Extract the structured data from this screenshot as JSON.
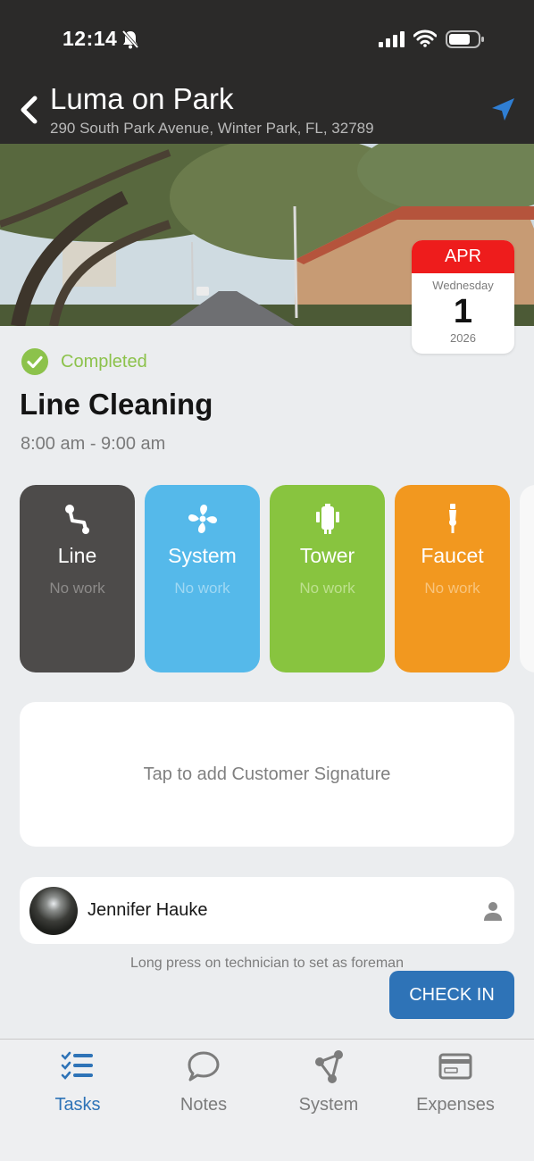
{
  "status_bar": {
    "time": "12:14"
  },
  "header": {
    "title": "Luma on Park",
    "address": "290 South Park Avenue, Winter Park, FL, 32789"
  },
  "date": {
    "month": "APR",
    "weekday": "Wednesday",
    "day": "1",
    "year": "2026"
  },
  "task": {
    "status": "Completed",
    "title": "Line Cleaning",
    "time": "8:00 am - 9:00 am"
  },
  "tiles": [
    {
      "label": "Line",
      "sub": "No work",
      "icon": "line-icon",
      "color": "#4d4b4a"
    },
    {
      "label": "System",
      "sub": "No work",
      "icon": "fan-icon",
      "color": "#55b9ea"
    },
    {
      "label": "Tower",
      "sub": "No work",
      "icon": "tower-icon",
      "color": "#88c43f"
    },
    {
      "label": "Faucet",
      "sub": "No work",
      "icon": "faucet-icon",
      "color": "#f2981f"
    }
  ],
  "signature": {
    "prompt": "Tap to add Customer Signature"
  },
  "technician": {
    "name": "Jennifer Hauke"
  },
  "hint": "Long press on technician to set as foreman",
  "actions": {
    "check_in": "CHECK IN"
  },
  "tabs": [
    {
      "label": "Tasks",
      "icon": "tasks-icon",
      "active": true
    },
    {
      "label": "Notes",
      "icon": "chat-bubble-icon",
      "active": false
    },
    {
      "label": "System",
      "icon": "share-nodes-icon",
      "active": false
    },
    {
      "label": "Expenses",
      "icon": "card-icon",
      "active": false
    }
  ],
  "colors": {
    "header_bg": "#2b2a29",
    "accent_blue": "#2e73b7",
    "completed_green": "#8cc24b",
    "date_red": "#ee1c1c"
  }
}
